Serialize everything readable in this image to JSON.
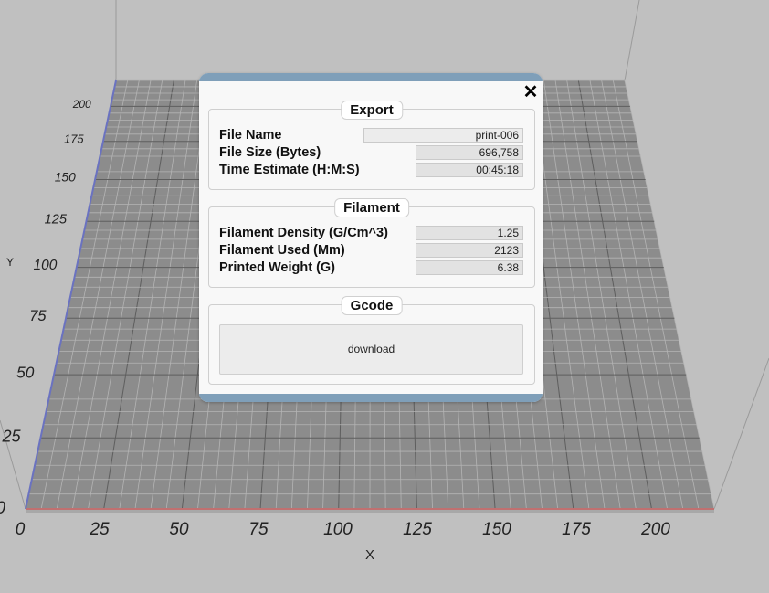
{
  "viewport": {
    "x_axis": {
      "label": "X",
      "ticks": [
        "0",
        "25",
        "50",
        "75",
        "100",
        "125",
        "150",
        "175",
        "200"
      ]
    },
    "y_axis": {
      "label": "Y",
      "ticks": [
        "0",
        "25",
        "50",
        "75",
        "100",
        "125",
        "150",
        "175",
        "200"
      ]
    },
    "colors": {
      "background": "#c0c0c0",
      "bed": "#8a8a8a",
      "x_axis_line": "#c07070",
      "y_axis_line": "#6a72c0"
    }
  },
  "dialog": {
    "close_glyph": "✕",
    "export": {
      "title": "Export",
      "file_name_label": "File Name",
      "file_name_value": "print-006",
      "file_size_label": "File Size (Bytes)",
      "file_size_value": "696,758",
      "time_label": "Time Estimate (H:M:S)",
      "time_value": "00:45:18"
    },
    "filament": {
      "title": "Filament",
      "density_label": "Filament Density (G/Cm^3)",
      "density_value": "1.25",
      "used_label": "Filament Used (Mm)",
      "used_value": "2123",
      "weight_label": "Printed Weight (G)",
      "weight_value": "6.38"
    },
    "gcode": {
      "title": "Gcode",
      "download_label": "download"
    },
    "colors": {
      "header_bar": "#7f9fb9",
      "panel": "#f8f8f8"
    }
  }
}
